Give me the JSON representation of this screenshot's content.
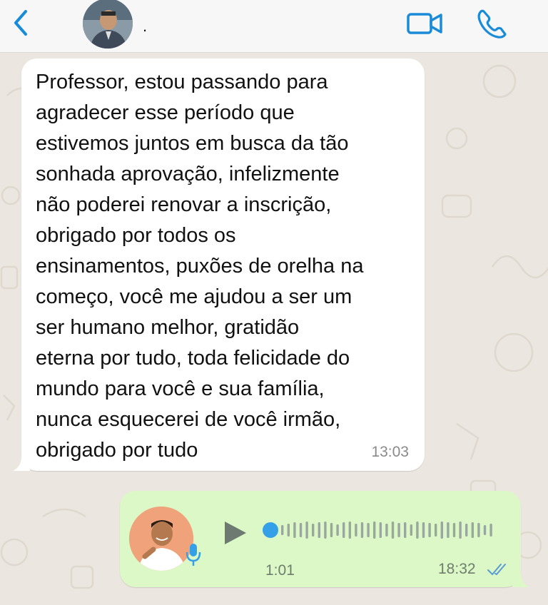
{
  "header": {
    "contact_name": ".",
    "back_icon": "chevron-left-icon",
    "video_icon": "video-camera-icon",
    "call_icon": "phone-icon",
    "accent_color": "#1a8bd8"
  },
  "messages": {
    "incoming": {
      "text": "Professor, estou passando para\nagradecer  esse período que\nestivemos  juntos em busca  da tão\nsonhada aprovação, infelizmente\nnão poderei renovar a inscrição,\nobrigado por  todos os\nensinamentos, puxões de orelha na\ncomeço,  você  me ajudou a ser um\nser humano  melhor, gratidão\neterna por tudo, toda felicidade do\nmundo para  você e sua família,\nnunca esquecerei de você  irmão,\nobrigado por tudo",
      "time": "13:03",
      "bubble_color": "#ffffff"
    },
    "outgoing_voice": {
      "duration": "1:01",
      "time": "18:32",
      "status_icon": "double-check-icon",
      "progress": 0,
      "bubble_color": "#dcf8c6"
    }
  }
}
